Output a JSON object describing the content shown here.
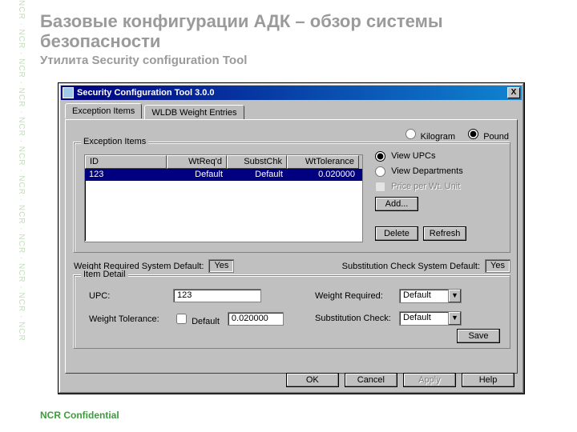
{
  "slide": {
    "title": "Базовые конфигурации АДК – обзор системы безопасности",
    "subtitle": "Утилита Security configuration Tool",
    "footer": "NCR Confidential",
    "side_text": "NCR · NCR · NCR · NCR · NCR · NCR · NCR · NCR · NCR · NCR · NCR · NCR"
  },
  "dialog": {
    "title": "Security Configuration Tool 3.0.0",
    "close_x": "X",
    "tabs": {
      "exception": "Exception Items",
      "wldb": "WLDB Weight Entries"
    },
    "units": {
      "kg": "Kilogram",
      "lb": "Pound",
      "selected": "lb"
    },
    "exception_group": {
      "label": "Exception Items",
      "columns": {
        "id": "ID",
        "wtreq": "WtReq'd",
        "substchk": "SubstChk",
        "wttol": "WtTolerance"
      },
      "row": {
        "id": "123",
        "wtreq": "Default",
        "substchk": "Default",
        "wttol": "0.020000"
      },
      "view_upcs": "View UPCs",
      "view_depts": "View Departments",
      "price_per_wt": "Price per Wt. Unit",
      "add": "Add...",
      "delete": "Delete",
      "refresh": "Refresh"
    },
    "sys": {
      "wr_label": "Weight Required System Default:",
      "wr_value": "Yes",
      "sc_label": "Substitution Check System Default:",
      "sc_value": "Yes"
    },
    "detail": {
      "label": "Item Detail",
      "upc_label": "UPC:",
      "upc_value": "123",
      "wr_label": "Weight Required:",
      "wr_value": "Default",
      "wt_label": "Weight Tolerance:",
      "wt_default_cb": "Default",
      "wt_value": "0.020000",
      "sc_label": "Substitution Check:",
      "sc_value": "Default",
      "save": "Save"
    },
    "buttons": {
      "ok": "OK",
      "cancel": "Cancel",
      "apply": "Apply",
      "help": "Help"
    }
  }
}
